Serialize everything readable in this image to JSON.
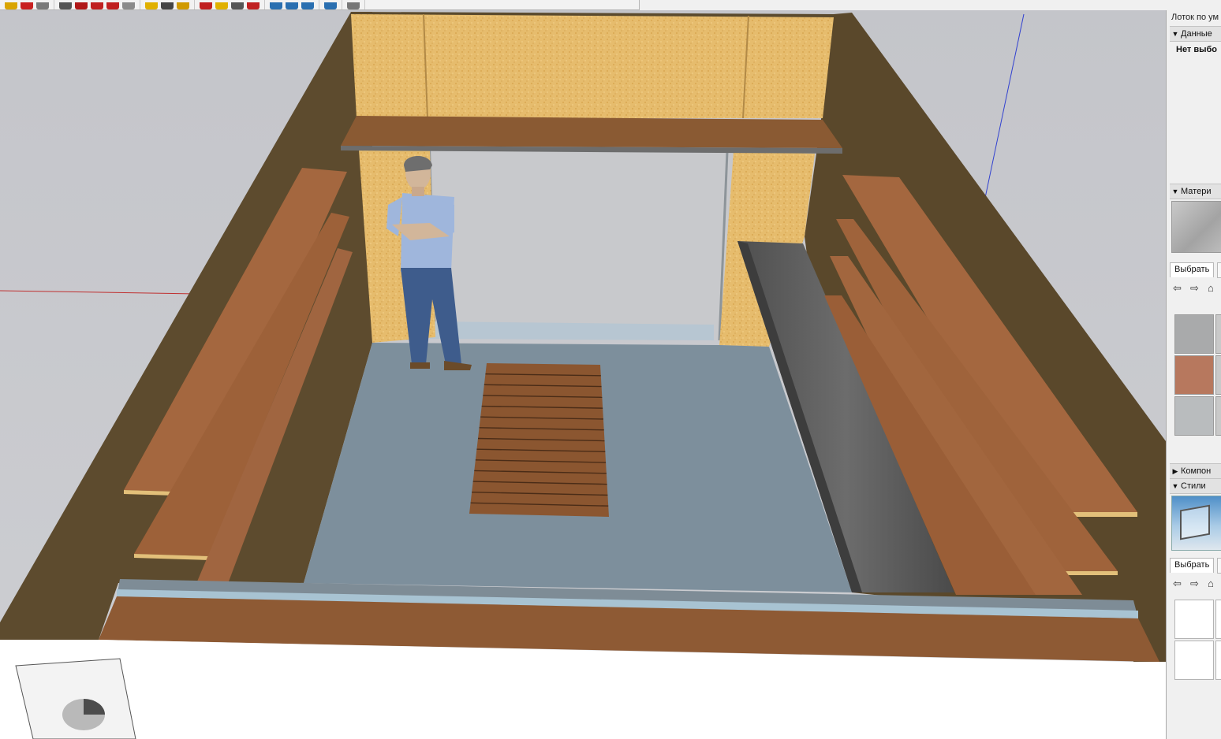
{
  "toolbar": {
    "groups": [
      {
        "icons": [
          "pencil-icon",
          "line-icon",
          "eraser-icon"
        ],
        "colors": [
          "#d9a400",
          "#c82020",
          "#7a7a7a"
        ]
      },
      {
        "icons": [
          "paint-bucket-icon",
          "move-icon",
          "push-pull-icon",
          "rotate-icon",
          "scale-icon"
        ],
        "colors": [
          "#555555",
          "#b01818",
          "#c02020",
          "#c02020",
          "#8a8a8a"
        ]
      },
      {
        "icons": [
          "tape-measure-icon",
          "dimension-icon",
          "protractor-icon"
        ],
        "colors": [
          "#e0b000",
          "#444444",
          "#d09a00"
        ]
      },
      {
        "icons": [
          "orbit-icon",
          "pan-icon",
          "zoom-icon",
          "zoom-extents-icon"
        ],
        "colors": [
          "#c02020",
          "#e0b000",
          "#555555",
          "#c02020"
        ]
      },
      {
        "icons": [
          "warehouse-icon",
          "share-model-icon",
          "get-models-icon"
        ],
        "colors": [
          "#2a6fb0",
          "#2a6fb0",
          "#2a6fb0"
        ]
      },
      {
        "icons": [
          "extension-warehouse-icon"
        ],
        "colors": [
          "#2a6fb0"
        ]
      },
      {
        "icons": [
          "help-icon"
        ],
        "colors": [
          "#777777"
        ]
      }
    ]
  },
  "tray": {
    "title": "Лоток по ум",
    "entity_info": {
      "label": "Данные",
      "expanded": true,
      "empty_text": "Нет выбо"
    },
    "materials": {
      "label": "Матери",
      "expanded": true,
      "tab_select": "Выбрать",
      "nav": [
        "back-icon",
        "forward-icon",
        "home-icon"
      ],
      "swatches": [
        "#a9aaab",
        "#b7785e",
        "#b9bcbe"
      ]
    },
    "components": {
      "label": "Компон",
      "expanded": false
    },
    "styles": {
      "label": "Стили",
      "expanded": true,
      "tab_select": "Выбрать",
      "nav": [
        "back-icon",
        "forward-icon",
        "home-icon"
      ]
    }
  },
  "scene": {
    "colors": {
      "sky": "#c6c7cc",
      "wall_outer": "#5d4b2e",
      "osb": "#e6bc6d",
      "board": "#a4673f",
      "floor": "#7d8f9c",
      "dark_board": "#545454",
      "doorway": "#c8c9cc",
      "snow": "#ffffff"
    },
    "person": {
      "shirt": "#9fb6dc",
      "jeans": "#3e5c8c"
    }
  }
}
